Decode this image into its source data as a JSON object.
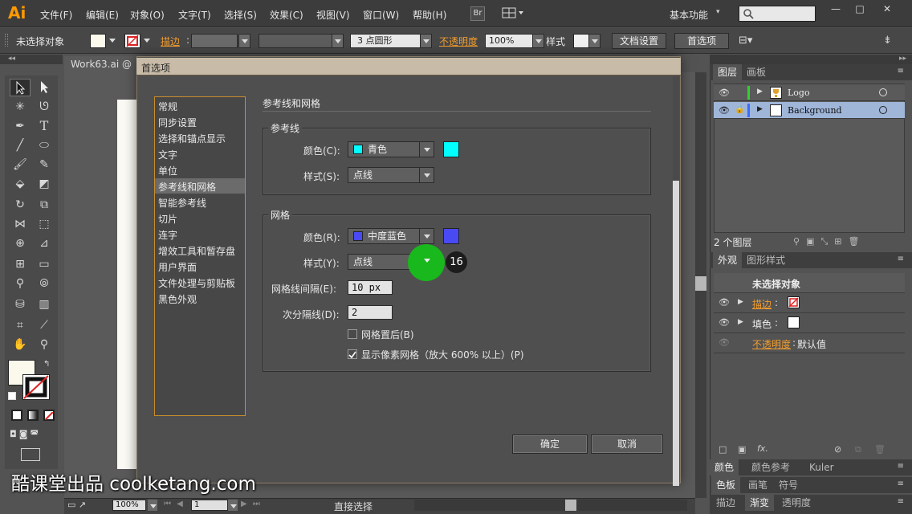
{
  "app": {
    "logo": "Ai"
  },
  "menu": [
    "文件(F)",
    "编辑(E)",
    "对象(O)",
    "文字(T)",
    "选择(S)",
    "效果(C)",
    "视图(V)",
    "窗口(W)",
    "帮助(H)"
  ],
  "menubar": {
    "bridge_label": "Br",
    "workspace": "基本功能",
    "window_controls": [
      "—",
      "□",
      "✕"
    ]
  },
  "control_bar": {
    "no_selection": "未选择对象",
    "stroke_label": "描边",
    "brush_value": "3 点圆形",
    "opacity_label": "不透明度",
    "opacity_value": "100%",
    "style_label": "样式",
    "doc_settings": "文档设置",
    "preferences": "首选项"
  },
  "document": {
    "tab_title": "Work63.ai @"
  },
  "dialog": {
    "title": "首选项",
    "categories": [
      "常规",
      "同步设置",
      "选择和锚点显示",
      "文字",
      "单位",
      "参考线和网格",
      "智能参考线",
      "切片",
      "连字",
      "增效工具和暂存盘",
      "用户界面",
      "文件处理与剪贴板",
      "黑色外观"
    ],
    "selected_category": "参考线和网格",
    "section_title": "参考线和网格",
    "guides": {
      "group_title": "参考线",
      "color_label": "颜色(C):",
      "color_value": "青色",
      "color_hex": "#00ffff",
      "style_label": "样式(S):",
      "style_value": "点线"
    },
    "grid": {
      "group_title": "网格",
      "color_label": "颜色(R):",
      "color_value": "中度蓝色",
      "color_hex": "#4a4af5",
      "style_label": "样式(Y):",
      "style_value": "点线",
      "spacing_label": "网格线间隔(E):",
      "spacing_value": "10 px",
      "subdivisions_label": "次分隔线(D):",
      "subdivisions_value": "2",
      "grids_in_back_label": "网格置后(B)",
      "grids_in_back_checked": false,
      "pixel_grid_label": "显示像素网格（放大 600% 以上）(P)",
      "pixel_grid_checked": true
    },
    "ok": "确定",
    "cancel": "取消"
  },
  "step_badge": "16",
  "layers_panel": {
    "tabs": [
      "图层",
      "画板"
    ],
    "layers": [
      {
        "name": "Logo",
        "color": "#2fd12f"
      },
      {
        "name": "Background",
        "color": "#3b6cff"
      }
    ],
    "count": "2 个图层"
  },
  "appearance_panel": {
    "tabs": [
      "外观",
      "图形样式"
    ],
    "title": "未选择对象",
    "stroke_label": "描边",
    "fill_label": "填色",
    "opacity_label": "不透明度",
    "opacity_value": "默认值",
    "fx": "fx."
  },
  "color_panel": {
    "tabs": [
      "颜色",
      "颜色参考",
      "Kuler"
    ]
  },
  "swatch_panel": {
    "tabs": [
      "色板",
      "画笔",
      "符号"
    ]
  },
  "stroke_panel": {
    "tabs": [
      "描边",
      "渐变",
      "透明度"
    ]
  },
  "status_bar": {
    "zoom": "100%",
    "artboard": "1",
    "tool": "直接选择"
  },
  "watermark": "酷课堂出品 coolketang.com"
}
